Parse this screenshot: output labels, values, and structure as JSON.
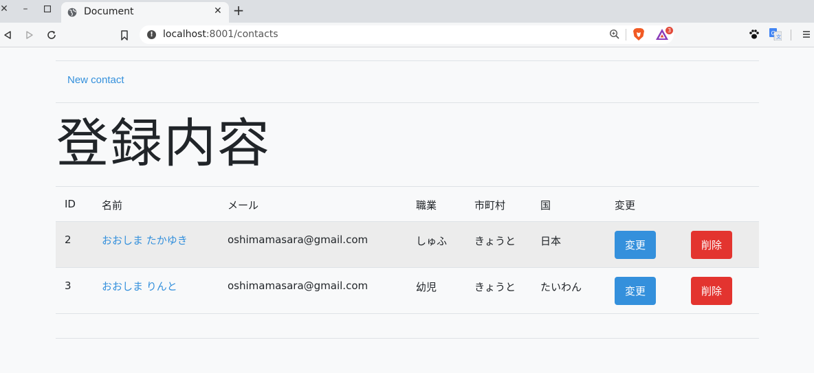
{
  "browser": {
    "tab_title": "Document",
    "url_host": "localhost",
    "url_rest": ":8001/contacts",
    "rewards_count": "3"
  },
  "page": {
    "new_contact_link": "New contact",
    "title": "登録内容"
  },
  "table": {
    "headers": {
      "id": "ID",
      "name": "名前",
      "email": "メール",
      "job": "職業",
      "city": "市町村",
      "country": "国",
      "edit": "変更"
    },
    "rows": [
      {
        "id": "2",
        "name": "おおしま たかゆき",
        "email": "oshimamasara@gmail.com",
        "job": "しゅふ",
        "city": "きょうと",
        "country": "日本",
        "edit_label": "変更",
        "delete_label": "削除"
      },
      {
        "id": "3",
        "name": "おおしま りんと",
        "email": "oshimamasara@gmail.com",
        "job": "幼児",
        "city": "きょうと",
        "country": "たいわん",
        "edit_label": "変更",
        "delete_label": "削除"
      }
    ]
  },
  "colors": {
    "link": "#3490dc",
    "edit_button": "#3490dc",
    "delete_button": "#e3342f"
  }
}
